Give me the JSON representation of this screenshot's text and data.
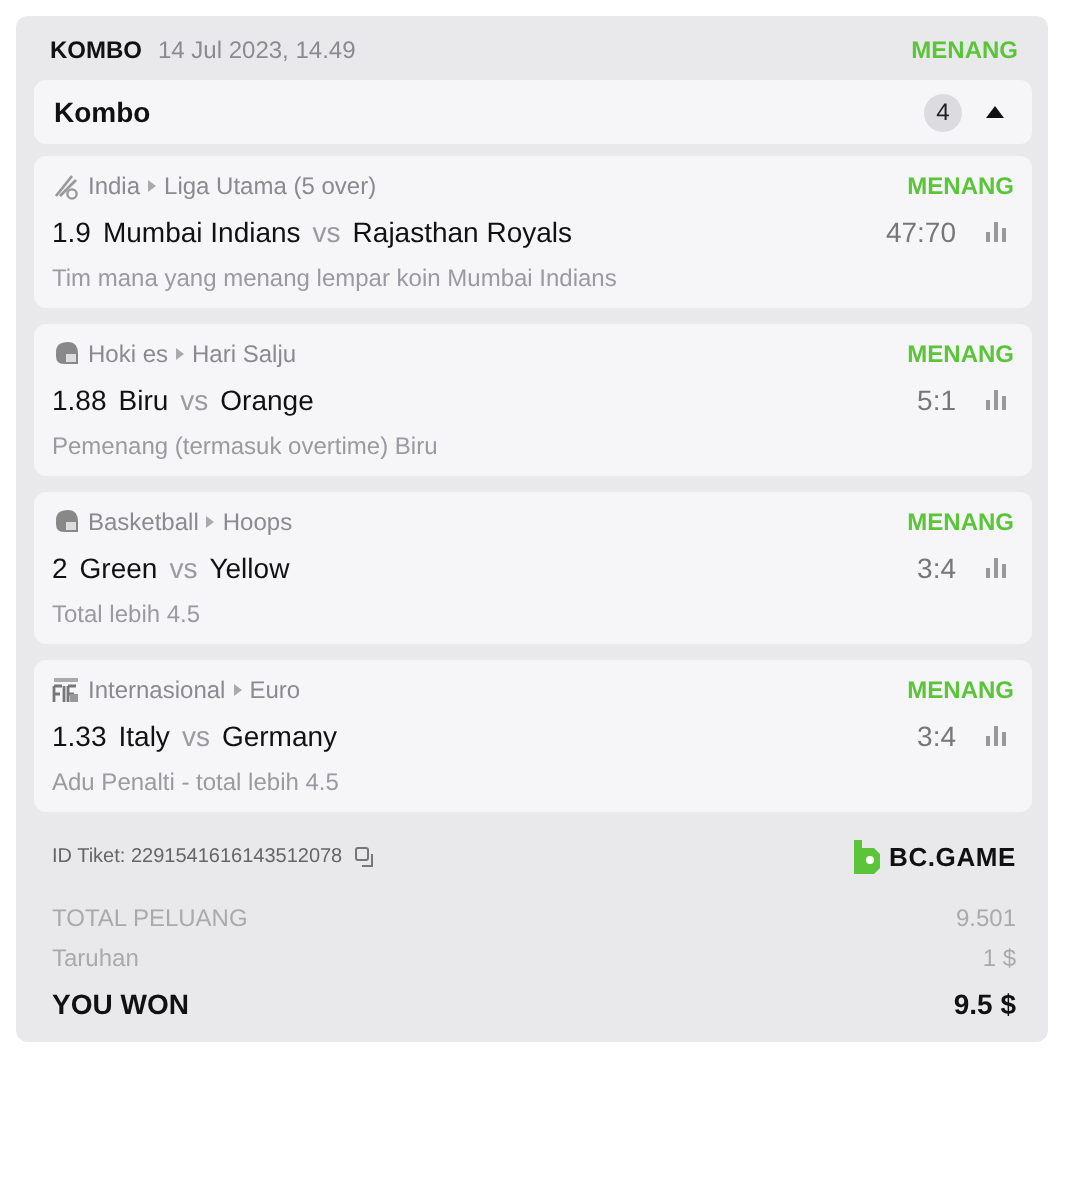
{
  "ticket": {
    "type": "KOMBO",
    "date": "14 Jul 2023, 14.49",
    "status": "MENANG"
  },
  "group": {
    "title": "Kombo",
    "count": "4",
    "expanded": true
  },
  "legs": [
    {
      "kind": "cricket",
      "country": "India",
      "league": "Liga Utama (5 over)",
      "status": "MENANG",
      "odds": "1.9",
      "home": "Mumbai Indians",
      "vs": "vs",
      "away": "Rajasthan Royals",
      "score": "47:70",
      "market": "Tim mana yang menang lempar koin Mumbai Indians"
    },
    {
      "kind": "hockey",
      "country": "Hoki es",
      "league": "Hari Salju",
      "status": "MENANG",
      "odds": "1.88",
      "home": "Biru",
      "vs": "vs",
      "away": "Orange",
      "score": "5:1",
      "market": "Pemenang (termasuk overtime) Biru"
    },
    {
      "kind": "hockey",
      "country": "Basketball",
      "league": "Hoops",
      "status": "MENANG",
      "odds": "2",
      "home": "Green",
      "vs": "vs",
      "away": "Yellow",
      "score": "3:4",
      "market": "Total lebih 4.5"
    },
    {
      "kind": "fifa",
      "country": "Internasional",
      "league": "Euro",
      "status": "MENANG",
      "odds": "1.33",
      "home": "Italy",
      "vs": "vs",
      "away": "Germany",
      "score": "3:4",
      "market": "Adu Penalti - total lebih 4.5"
    }
  ],
  "ticket_id": "ID Tiket: 2291541616143512078",
  "brand": "BC.GAME",
  "summary": [
    {
      "kind": "muted",
      "label": "TOTAL PELUANG",
      "value": "9.501"
    },
    {
      "kind": "muted",
      "label": "Taruhan",
      "value": "1 $"
    },
    {
      "kind": "strong",
      "label": "YOU WON",
      "value": "9.5 $"
    }
  ]
}
